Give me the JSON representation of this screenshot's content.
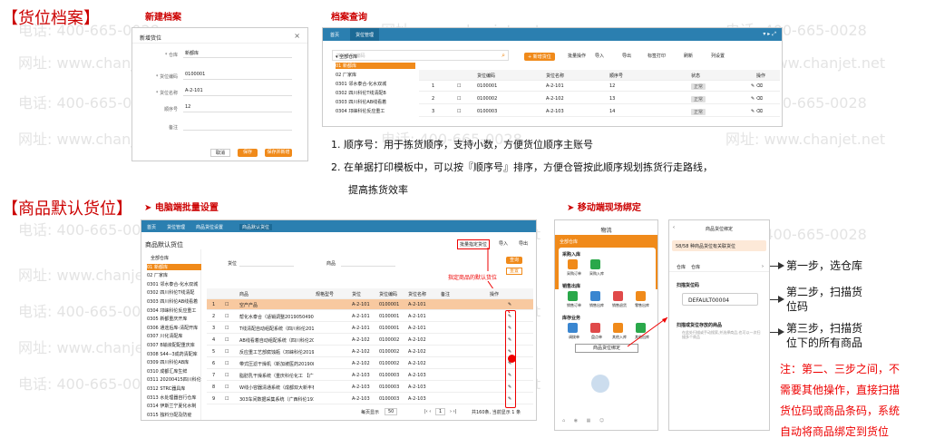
{
  "watermark": {
    "phone": "电话: 400-665-0028",
    "site": "网址: www.chanjet.net"
  },
  "sections": {
    "location_archive": "【货位档案】",
    "default_location": "【商品默认货位】"
  },
  "subtitles": {
    "new_archive": "新建档案",
    "archive_query": "档案查询",
    "pc_batch": "电脑端批量设置",
    "mobile_bind": "移动端现场绑定"
  },
  "new_dialog": {
    "title": "新增货位",
    "fields": [
      {
        "label": "仓库",
        "value": "新都库"
      },
      {
        "label": "货位编码",
        "value": "0100001"
      },
      {
        "label": "货位名称",
        "value": "A-2-101"
      },
      {
        "label": "顺序号",
        "value": "12"
      },
      {
        "label": "备注",
        "value": ""
      }
    ],
    "buttons": {
      "cancel": "取消",
      "save": "保存",
      "save_new": "保存并新增"
    }
  },
  "query_window": {
    "tabs": [
      "首页",
      "货位管理"
    ],
    "search_placeholder": "搜索名称/编码",
    "toolbar": [
      "+ 新增货位",
      "批量操作",
      "导入",
      "导出",
      "标签打印",
      "刷新",
      "列设置"
    ],
    "tree": [
      "全部仓库",
      "01 新都库",
      "02 厂家库",
      "0301 邻水泰合-化水双城",
      "0302 四川科伦T线清配B",
      "0303 四川科伦AB线看着",
      "0304 邛崃科伦反应重工"
    ],
    "columns": [
      "",
      "",
      "货位编码",
      "货位名称",
      "顺序号",
      "状态",
      "操作"
    ],
    "rows": [
      {
        "n": "1",
        "code": "0100001",
        "name": "A-2-101",
        "seq": "12",
        "status": "正常"
      },
      {
        "n": "2",
        "code": "0100002",
        "name": "A-2-102",
        "seq": "13",
        "status": "正常"
      },
      {
        "n": "3",
        "code": "0100003",
        "name": "A-2-103",
        "seq": "14",
        "status": "正常"
      }
    ]
  },
  "notes": [
    "1.  顺序号：用于拣货顺序，支持小数，方便货位顺序主账号",
    "2.  在单据打印模板中，可以按『顺序号』排序，方便仓管按此顺序规划拣货行走路线，",
    "提高拣货效率"
  ],
  "pc_window": {
    "tabs": [
      "首页",
      "货位管理",
      "商品货位设置",
      "商品默认货位"
    ],
    "title": "商品默认货位",
    "toolbar": [
      "批量指定货位",
      "导入",
      "导出"
    ],
    "filters": {
      "loc": "货位",
      "goods": "商品"
    },
    "buttons": {
      "query": "查询",
      "reset": "重置"
    },
    "annotation": "指定商品的默认货位",
    "tree": [
      "全部仓库",
      "01 新都库",
      "02 厂家库",
      "0301 邻水泰合-化水双城",
      "0302 四川科伦T线清配",
      "0303 四川科伦AB线看着",
      "0304 邛崃科伦反应重工",
      "0305 新都重庆开库",
      "0306 通途后库-清配开库",
      "0307 川化清配库",
      "0307 B输液配配重庆库",
      "0308 S44--3成药清配库",
      "0309 四川科伦AB库",
      "0310 成都汇库生鲜",
      "0311 20200415四川科伦",
      "0312 STRC器具库",
      "0313 水处理器自行仓库",
      "0314 伊斯兰宁夏化水制",
      "0315 独料分配及防疫"
    ],
    "columns": [
      "",
      "",
      "商品",
      "规格型号",
      "货位",
      "货位编码",
      "货位名称",
      "备注",
      "操作"
    ],
    "rows": [
      {
        "n": "1",
        "goods": "空产产品",
        "spec": "",
        "loc": "A-2-101",
        "code": "0100001",
        "name": "A-2-101"
      },
      {
        "n": "2",
        "goods": "帮化水泰合（适销调整2019050490）",
        "spec": "",
        "loc": "A-2-101",
        "code": "0100001",
        "name": "A-2-101"
      },
      {
        "n": "3",
        "goods": "T线清配自动组配系统（四川科伦2019050327）",
        "spec": "",
        "loc": "A-2-101",
        "code": "0100001",
        "name": "A-2-101"
      },
      {
        "n": "4",
        "goods": "AB线看着自动组配系统（四川科伦2019070319）",
        "spec": "",
        "loc": "A-2-102",
        "code": "0100002",
        "name": "A-2-102"
      },
      {
        "n": "5",
        "goods": "反应重工艺部腐蚀瓶（邛崃科伦2019082701）",
        "spec": "",
        "loc": "A-2-102",
        "code": "0100002",
        "name": "A-2-102"
      },
      {
        "n": "6",
        "goods": "带式压滤干燥机（新加坡医药2019082201）",
        "spec": "",
        "loc": "A-2-102",
        "code": "0100002",
        "name": "A-2-102"
      },
      {
        "n": "7",
        "goods": "脂肪乳干燥系统（重庆科伦化工 【广西启能】）",
        "spec": "",
        "loc": "A-2-103",
        "code": "0100003",
        "name": "A-2-103"
      },
      {
        "n": "8",
        "goods": "W线小容器清通系统（成都双大新丰有限公司2019...）",
        "spec": "",
        "loc": "A-2-103",
        "code": "0100003",
        "name": "A-2-103"
      },
      {
        "n": "9",
        "goods": "303车间数据采集系统（广西科伦19118）",
        "spec": "",
        "loc": "A-2-103",
        "code": "0100003",
        "name": "A-2-103"
      }
    ],
    "pager": {
      "per_page_label": "每页显示",
      "per_page": "50",
      "page": "1",
      "total": "共160条, 当前显示 1 条"
    }
  },
  "mobile_left": {
    "title": "物流",
    "store": "全部仓库",
    "groups": [
      {
        "name": "采购入库",
        "items": [
          "采购订单",
          "采购入库"
        ]
      },
      {
        "name": "销售出库",
        "items": [
          "销售订单",
          "销售出库",
          "销售退货",
          "零售出库"
        ]
      },
      {
        "name": "库存业务",
        "items": [
          "调拨单",
          "盘点单",
          "其他入库",
          "其他出库"
        ]
      }
    ],
    "bind_button": "商品货位绑定"
  },
  "mobile_right": {
    "title": "商品货位绑定",
    "hint": "58/58 种商品货位有关联货位",
    "store_label": "仓库",
    "store_value": "仓库",
    "step1": "扫描货位码",
    "code": "DEFAULT00004",
    "step2": "扫描或货位存放的商品",
    "step2_hint": "在此处扫描或手动搜索,并选择商品,也可以一次扫描多个商品"
  },
  "steps": [
    "第一步，选仓库",
    "第二步，扫描货位码",
    "第三步，扫描货位下的所有商品"
  ],
  "steps_wrapped": [
    "第一步，选仓库",
    "第二步，扫描货",
    "位码",
    "第三步，扫描货",
    "位下的所有商品"
  ],
  "red_note": [
    "注：第二、三步之间，不",
    "需要其他操作，直接扫描",
    "货位码或商品条码，系统",
    "自动将商品绑定到货位"
  ],
  "colors": {
    "accent": "#f08a1a",
    "title_red": "#cc0000",
    "nav_blue": "#2b7fb0"
  }
}
